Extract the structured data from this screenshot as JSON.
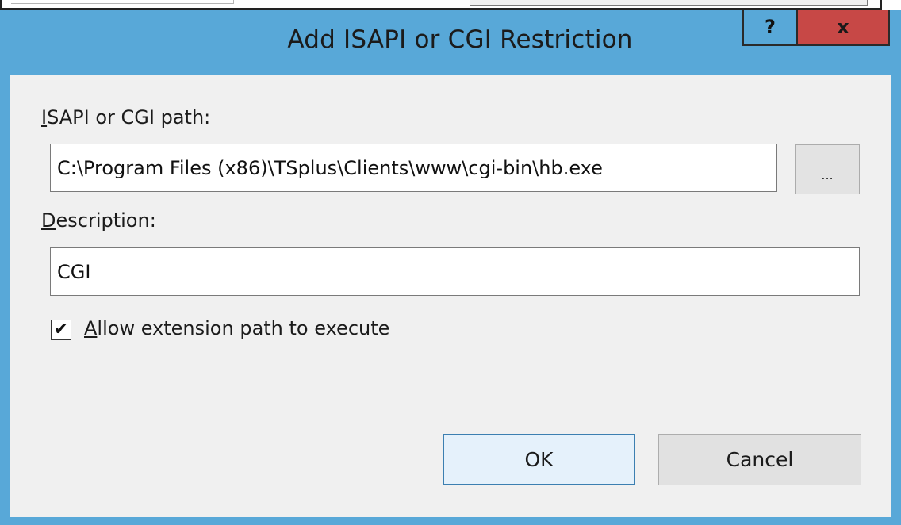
{
  "dialog": {
    "title": "Add ISAPI or CGI Restriction",
    "help_label": "?",
    "close_label": "x",
    "path_label_accel": "I",
    "path_label_rest": "SAPI or CGI path:",
    "path_value": "C:\\Program Files (x86)\\TSplus\\Clients\\www\\cgi-bin\\hb.exe",
    "browse_label": "...",
    "description_label_accel": "D",
    "description_label_rest": "escription:",
    "description_value": "CGI",
    "allow_checked": true,
    "allow_label_accel": "A",
    "allow_label_rest": "llow extension path to execute",
    "ok_label": "OK",
    "cancel_label": "Cancel"
  },
  "colors": {
    "frame": "#58a8d8",
    "close": "#c74846",
    "client": "#f0f0f0",
    "ok_border": "#3c7fb1"
  }
}
